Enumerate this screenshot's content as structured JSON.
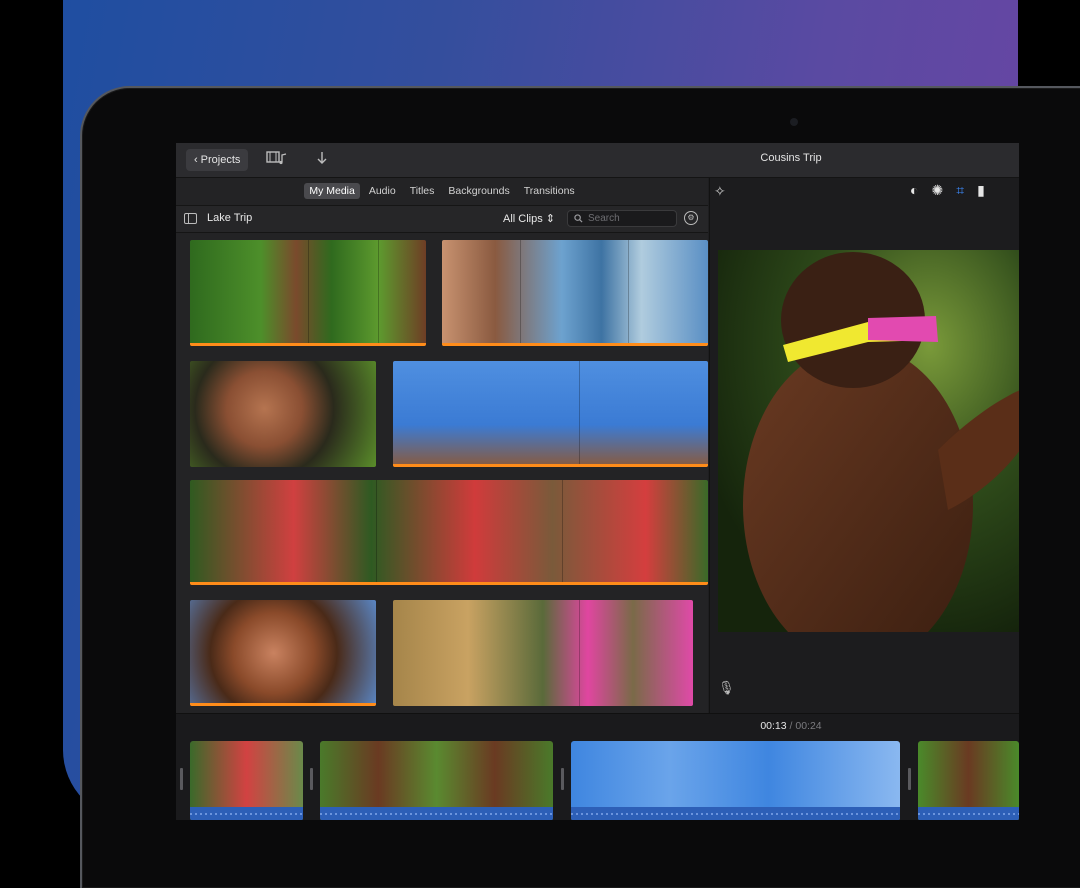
{
  "app": {
    "window_title": "Cousins Trip",
    "projects_button": "Projects"
  },
  "browser": {
    "tabs": [
      {
        "label": "My Media",
        "active": true
      },
      {
        "label": "Audio",
        "active": false
      },
      {
        "label": "Titles",
        "active": false
      },
      {
        "label": "Backgrounds",
        "active": false
      },
      {
        "label": "Transitions",
        "active": false
      }
    ],
    "library_name": "Lake Trip",
    "filter": "All Clips",
    "search_placeholder": "Search"
  },
  "timeline": {
    "current_time": "00:13",
    "separator": "/",
    "total_time": "00:24"
  },
  "icons": {
    "back": "chevron-left-icon",
    "media_music": "film-music-icon",
    "import": "download-arrow-icon",
    "magic": "magic-wand-icon",
    "color_balance": "color-balance-icon",
    "color_correct": "palette-icon",
    "crop": "crop-icon",
    "stabilize": "video-camera-icon",
    "microphone": "microphone-icon"
  },
  "colors": {
    "accent": "#3d8bff",
    "clip_marker": "#ff8c1a",
    "audio_track": "#2d5fb7"
  }
}
